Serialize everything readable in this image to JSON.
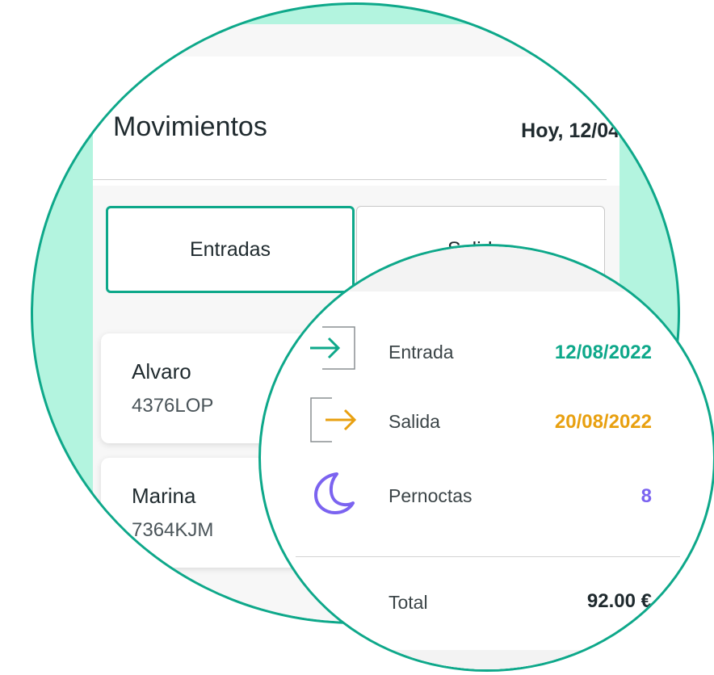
{
  "header": {
    "title": "Movimientos",
    "date": "Hoy, 12/04"
  },
  "tabs": [
    {
      "label": "Entradas",
      "active": true
    },
    {
      "label": "Salidas",
      "active": false
    }
  ],
  "guests": [
    {
      "name": "Alvaro",
      "plate": "4376LOP"
    },
    {
      "name": "Marina",
      "plate": "7364KJM"
    }
  ],
  "details": {
    "entrada": {
      "label": "Entrada",
      "value": "12/08/2022",
      "icon": "entry-arrow-icon",
      "color": "#0ea88a"
    },
    "salida": {
      "label": "Salida",
      "value": "20/08/2022",
      "icon": "exit-arrow-icon",
      "color": "#e8a010"
    },
    "pernoctas": {
      "label": "Pernoctas",
      "value": "8",
      "icon": "moon-icon",
      "color": "#7b63f0"
    },
    "total": {
      "label": "Total",
      "value": "92.00 €"
    }
  },
  "colors": {
    "accent": "#0ea88a",
    "background_tint": "#b3f4df"
  }
}
